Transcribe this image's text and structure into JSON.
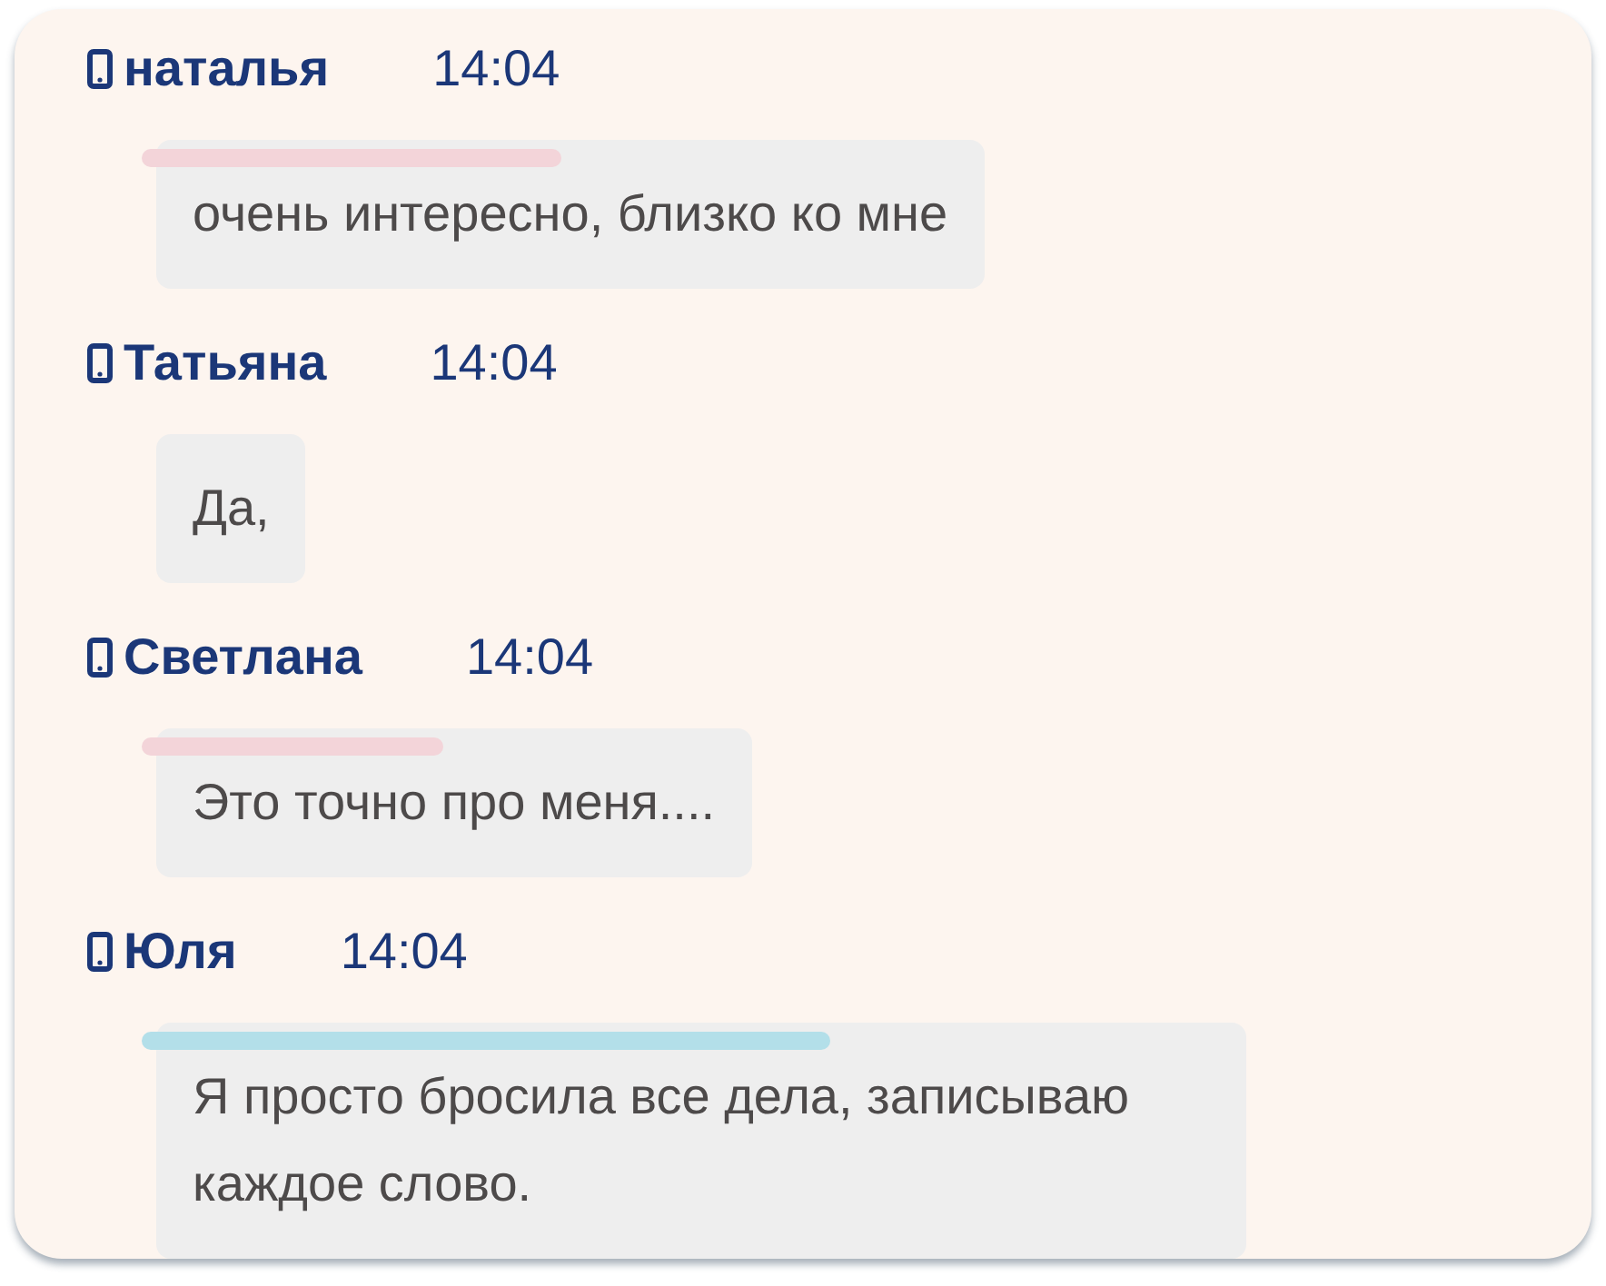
{
  "messages": [
    {
      "author": "наталья",
      "time": "14:04",
      "text": "очень интересно, близко ко мне",
      "color": "#f3d4d9"
    },
    {
      "author": "Татьяна",
      "time": "14:04",
      "text": "Да,"
    },
    {
      "author": "Светлана",
      "time": "14:04",
      "text": "Это точно про меня....",
      "color": "#f3d4d9"
    },
    {
      "author": "Юля",
      "time": "14:04",
      "text": "Я просто бросила все дела, записываю каждое слово.",
      "color": "#b3dfe9"
    }
  ]
}
